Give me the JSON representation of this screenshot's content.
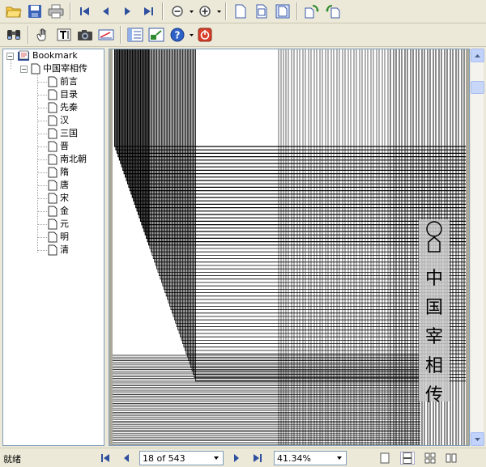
{
  "toolbar1": {
    "buttons": [
      "open-icon",
      "save-icon",
      "print-icon",
      "first-page-icon",
      "previous-page-icon",
      "next-page-icon",
      "last-page-icon",
      "zoom-out-icon",
      "zoom-in-icon",
      "single-page-icon",
      "fit-width-icon",
      "fit-page-icon",
      "rotate-clockwise-icon",
      "rotate-counterclockwise-icon"
    ]
  },
  "toolbar2": {
    "buttons": [
      "find-icon",
      "hand-tool-icon",
      "text-select-icon",
      "snapshot-icon",
      "annotate-icon",
      "bookmarks-panel-icon",
      "thumbnails-icon",
      "help-icon",
      "power-icon"
    ]
  },
  "bookmarks": {
    "root_label": "Bookmark",
    "book_label": "中国宰相传",
    "chapters": [
      "前言",
      "目录",
      "先秦",
      "汉",
      "三国",
      "晋",
      "南北朝",
      "隋",
      "唐",
      "宋",
      "金",
      "元",
      "明",
      "清"
    ]
  },
  "page_image": {
    "cover_title_chars": [
      "中",
      "国",
      "宰",
      "相",
      "传"
    ]
  },
  "statusbar": {
    "status_text": "就绪",
    "page_indicator": "18 of 543",
    "zoom_level": "41.34%"
  },
  "colors": {
    "chrome": "#ece9d8",
    "panel_border": "#7f9db9",
    "scroll_accent": "#c1d3fb"
  }
}
